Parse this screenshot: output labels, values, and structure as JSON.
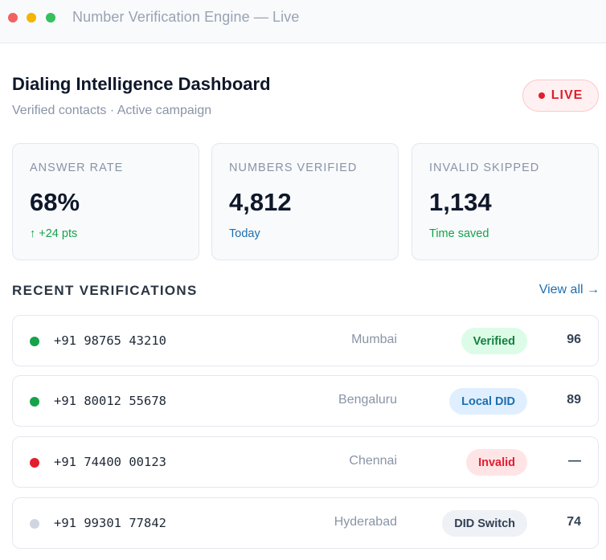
{
  "window": {
    "title": "Number Verification Engine — Live"
  },
  "header": {
    "title": "Dialing Intelligence Dashboard",
    "subtitle": "Verified contacts · Active campaign",
    "live_label": "LIVE"
  },
  "stats": [
    {
      "label": "ANSWER RATE",
      "value": "68%",
      "note": "↑ +24 pts",
      "note_color": "#16a34a"
    },
    {
      "label": "NUMBERS VERIFIED",
      "value": "4,812",
      "note": "Today",
      "note_color": "#1e6fb0"
    },
    {
      "label": "INVALID SKIPPED",
      "value": "1,134",
      "note": "Time saved",
      "note_color": "#16a34a"
    }
  ],
  "recent": {
    "title": "RECENT VERIFICATIONS",
    "view_all": "View all →",
    "rows": [
      {
        "phone": "+91 98765 43210",
        "city": "Mumbai",
        "status": "Verified",
        "score": "96",
        "dot": "green-dot-icon"
      },
      {
        "phone": "+91 80012 55678",
        "city": "Bengaluru",
        "status": "Local DID",
        "score": "89",
        "dot": "green-dot-icon"
      },
      {
        "phone": "+91 74400 00123",
        "city": "Chennai",
        "status": "Invalid",
        "score": "—",
        "dot": "red-dot-icon"
      },
      {
        "phone": "+91 99301 77842",
        "city": "Hyderabad",
        "status": "DID Switch",
        "score": "74",
        "dot": "gray-dot-icon"
      }
    ]
  },
  "colors": {
    "accent_blue": "#1e6fb0",
    "success_green": "#16a34a",
    "danger_red": "#e11d2e"
  }
}
